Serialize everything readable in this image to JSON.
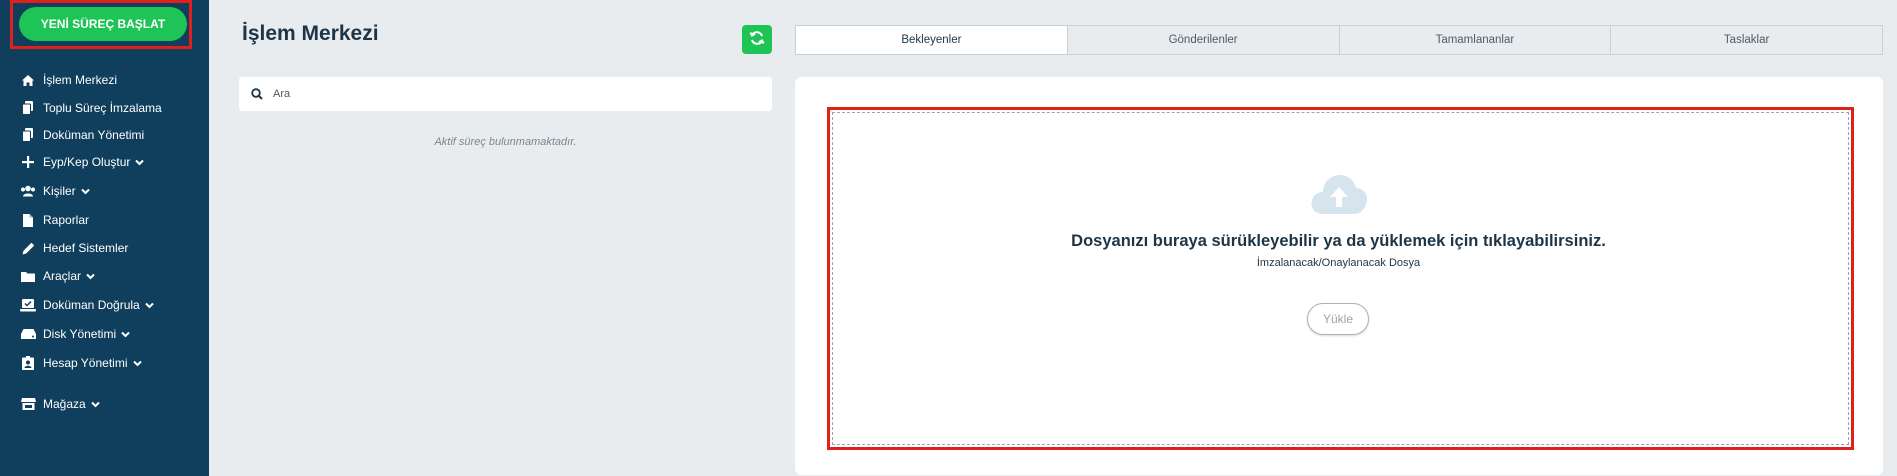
{
  "colors": {
    "sidebar": "#0f3f5c",
    "accent_green": "#1fc456",
    "highlight_red": "#e0201d",
    "title": "#1d3547"
  },
  "sidebar": {
    "new_process_label": "YENİ SÜREÇ BAŞLAT",
    "items": [
      {
        "label": "İşlem Merkezi",
        "icon": "home-icon",
        "has_chevron": false
      },
      {
        "label": "Toplu Süreç İmzalama",
        "icon": "copy-icon",
        "has_chevron": false
      },
      {
        "label": "Doküman Yönetimi",
        "icon": "documents-icon",
        "has_chevron": false
      },
      {
        "label": "Eyp/Kep Oluştur",
        "icon": "plus-icon",
        "has_chevron": true
      },
      {
        "label": "Kişiler",
        "icon": "users-icon",
        "has_chevron": true
      },
      {
        "label": "Raporlar",
        "icon": "file-icon",
        "has_chevron": false
      },
      {
        "label": "Hedef Sistemler",
        "icon": "pencil-icon",
        "has_chevron": false
      },
      {
        "label": "Araçlar",
        "icon": "folder-icon",
        "has_chevron": true
      },
      {
        "label": "Doküman Doğrula",
        "icon": "verify-icon",
        "has_chevron": true
      },
      {
        "label": "Disk Yönetimi",
        "icon": "hdd-icon",
        "has_chevron": true
      },
      {
        "label": "Hesap Yönetimi",
        "icon": "id-card-icon",
        "has_chevron": true
      },
      {
        "label": "Mağaza",
        "icon": "store-icon",
        "has_chevron": true
      }
    ]
  },
  "header": {
    "title": "İşlem Merkezi",
    "refresh_icon": "refresh-icon"
  },
  "tabs": [
    {
      "label": "Bekleyenler",
      "active": true
    },
    {
      "label": "Gönderilenler",
      "active": false
    },
    {
      "label": "Tamamlananlar",
      "active": false
    },
    {
      "label": "Taslaklar",
      "active": false
    }
  ],
  "search": {
    "placeholder": "Ara",
    "value": ""
  },
  "process_list": {
    "empty_message": "Aktif süreç bulunmamaktadır."
  },
  "upload": {
    "icon": "cloud-upload-icon",
    "title": "Dosyanızı buraya sürükleyebilir ya da yüklemek için tıklayabilirsiniz.",
    "subtitle": "İmzalanacak/Onaylanacak Dosya",
    "button_label": "Yükle"
  }
}
